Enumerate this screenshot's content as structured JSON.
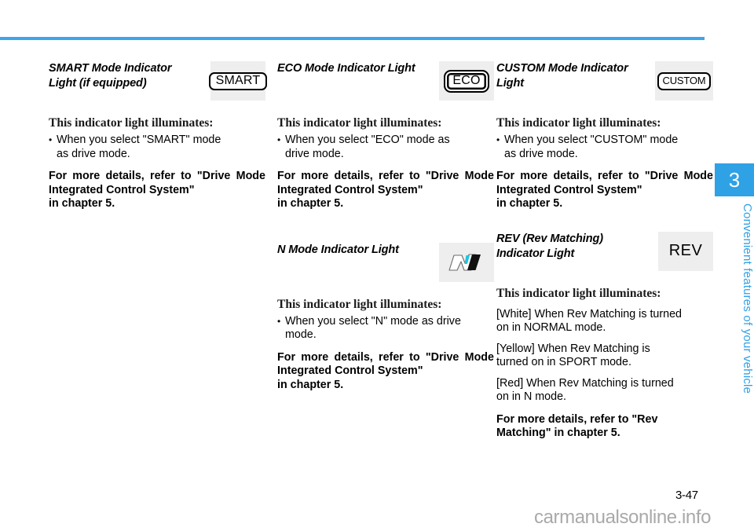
{
  "document": {
    "page_number": "3-47",
    "watermark": "carmanualsonline.info",
    "chapter_number": "3",
    "chapter_title": "Convenient features of your vehicle",
    "accent_color": "#2fa1e5",
    "rule_color": "#3ba6e8"
  },
  "sections": {
    "smart": {
      "title": "SMART Mode Indicator Light (if equipped)",
      "badge_text": "SMART",
      "illuminates_heading": "This indicator light illuminates:",
      "bullet": "When you select \"SMART\" mode",
      "bullet_last": "as drive mode.",
      "note_line1": "For more details, refer to \"Drive",
      "note_line2": "Mode Integrated Control System\"",
      "note_line3": "in chapter 5."
    },
    "eco": {
      "title": "ECO Mode Indicator Light",
      "badge_text": "ECO",
      "illuminates_heading": "This indicator light illuminates:",
      "bullet": "When you select \"ECO\" mode as",
      "bullet_last": "drive mode.",
      "note_line1": "For more details, refer to \"Drive",
      "note_line2": "Mode Integrated Control System\"",
      "note_line3": "in chapter 5."
    },
    "custom": {
      "title": "CUSTOM Mode Indicator Light",
      "badge_text": "CUSTOM",
      "illuminates_heading": "This indicator light illuminates:",
      "bullet": "When you select \"CUSTOM\" mode",
      "bullet_last": "as drive mode.",
      "note_line1": "For more details, refer to \"Drive",
      "note_line2": "Mode Integrated Control System\"",
      "note_line3": "in chapter 5."
    },
    "nmode": {
      "title": "N Mode Indicator Light",
      "badge_icon": "n-mode-logo-icon",
      "illuminates_heading": "This indicator light illuminates:",
      "bullet": "When you select \"N\" mode as drive",
      "bullet_last": "mode.",
      "note_line1": "For more details, refer to \"Drive",
      "note_line2": "Mode Integrated Control System\"",
      "note_line3": "in chapter 5."
    },
    "rev": {
      "title": "REV (Rev Matching) Indicator Light",
      "badge_text": "REV",
      "illuminates_heading": "This indicator light illuminates:",
      "white_line1": "[White] When Rev Matching is turned",
      "white_line2": "on in NORMAL mode.",
      "yellow_line1": "[Yellow] When Rev Matching is",
      "yellow_line2": "turned on in SPORT mode.",
      "red_line1": "[Red] When Rev Matching is turned",
      "red_line2": "on in N mode.",
      "note_line1": "For more details, refer to \"Rev",
      "note_line2": "Matching\" in chapter 5."
    }
  }
}
